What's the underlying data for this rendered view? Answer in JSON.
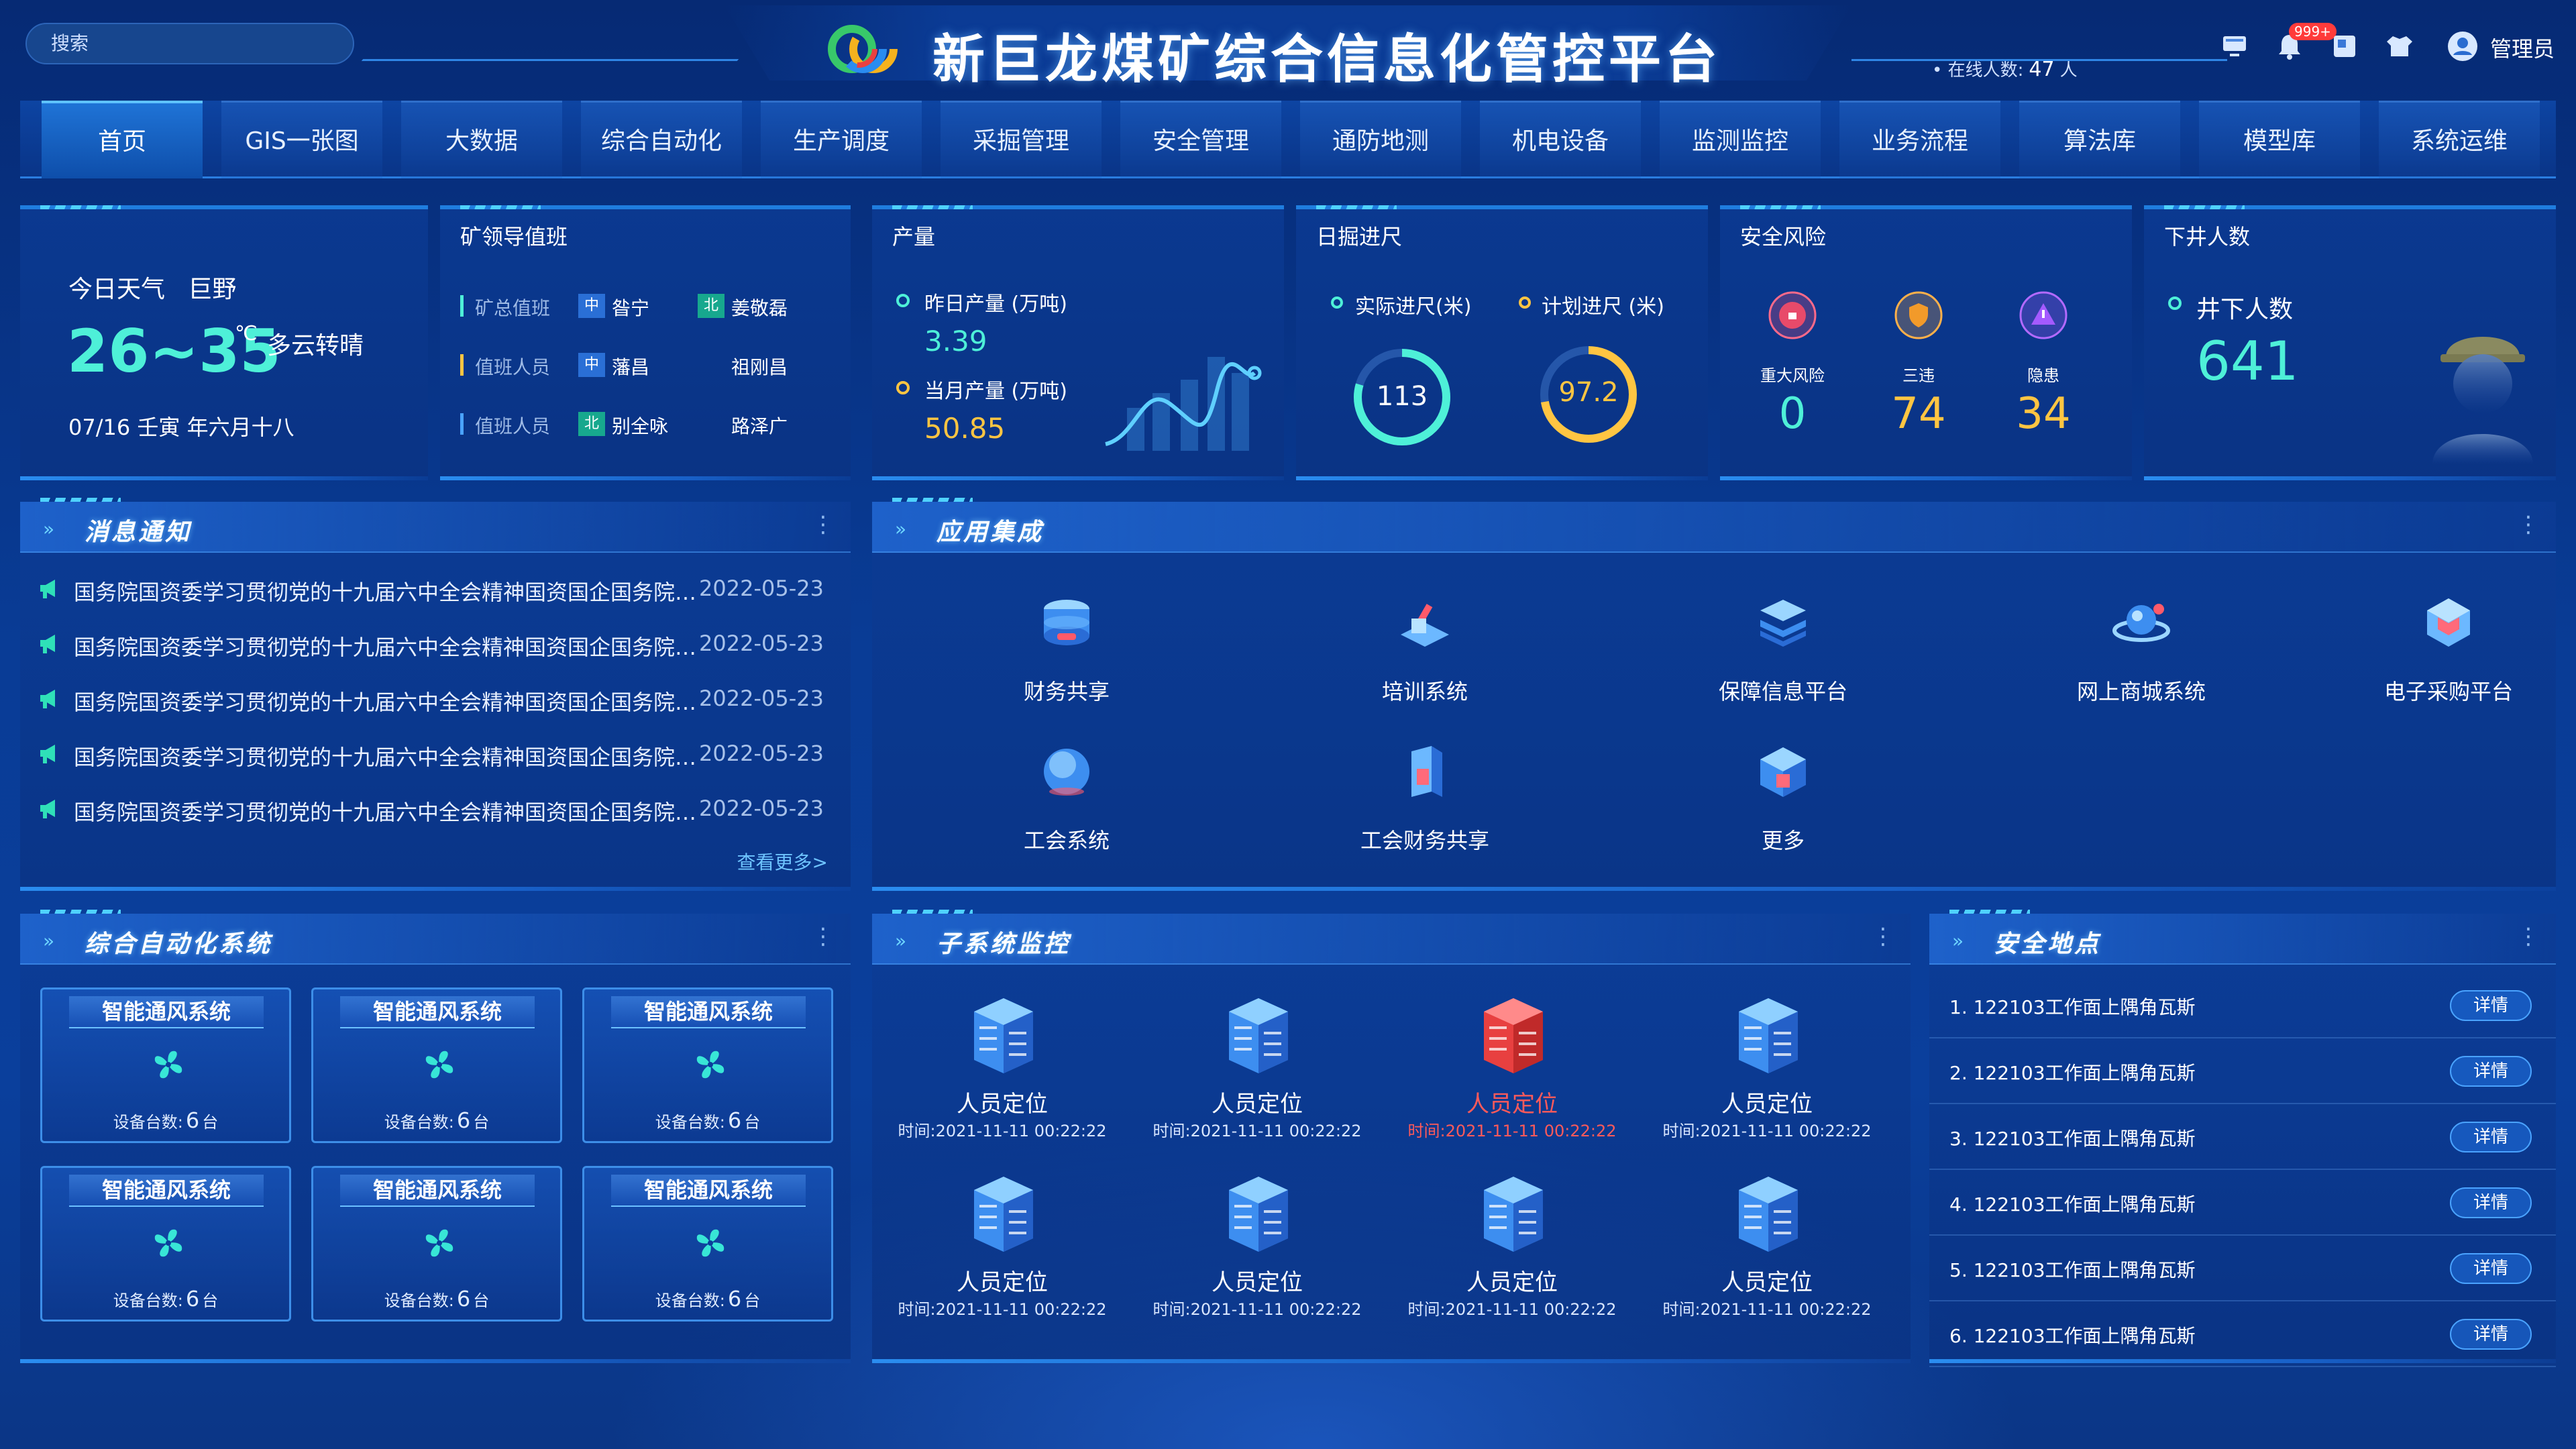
{
  "header": {
    "search_placeholder": "搜索",
    "title": "新巨龙煤矿综合信息化管控平台",
    "online_label": "在线人数:",
    "online_count": "47",
    "online_unit": "人",
    "badge": "999+",
    "user": "管理员"
  },
  "nav": [
    "首页",
    "GIS一张图",
    "大数据",
    "综合自动化",
    "生产调度",
    "采掘管理",
    "安全管理",
    "通防地测",
    "机电设备",
    "监测监控",
    "业务流程",
    "算法库",
    "模型库",
    "系统运维"
  ],
  "weather": {
    "label": "今日天气",
    "city": "巨野",
    "temp": "26~35",
    "unit": "℃",
    "desc": "多云转晴",
    "date": "07/16 壬寅 年六月十八"
  },
  "duty": {
    "title": "矿领导值班",
    "rows": [
      {
        "role": "矿总值班",
        "tag1": "中",
        "name1": "昝宁",
        "tag2": "北",
        "name2": "姜敬磊"
      },
      {
        "role": "值班人员",
        "tag1": "中",
        "name1": "藩昌",
        "tag2": "",
        "name2": "祖刚昌"
      },
      {
        "role": "值班人员",
        "tag1": "北",
        "name1": "别全咏",
        "tag2": "",
        "name2": "路泽广"
      }
    ]
  },
  "output": {
    "title": "产量",
    "yesterday_label": "昨日产量 (万吨)",
    "yesterday_value": "3.39",
    "month_label": "当月产量 (万吨)",
    "month_value": "50.85"
  },
  "advance": {
    "title": "日掘进尺",
    "actual_label": "实际进尺(米)",
    "plan_label": "计划进尺 (米)",
    "actual_value": "113",
    "plan_value": "97.2"
  },
  "risk": {
    "title": "安全风险",
    "items": [
      {
        "label": "重大风险",
        "value": "0"
      },
      {
        "label": "三违",
        "value": "74"
      },
      {
        "label": "隐患",
        "value": "34"
      }
    ]
  },
  "underground": {
    "title": "下井人数",
    "label": "井下人数",
    "value": "641"
  },
  "messages": {
    "title": "消息通知",
    "more": "查看更多>",
    "items": [
      {
        "text": "国务院国资委学习贯彻党的十九届六中全会精神国资国企国务院国资委学习贯彻党的十九届六中全会精神",
        "date": "2022-05-23"
      },
      {
        "text": "国务院国资委学习贯彻党的十九届六中全会精神国资国企国务院国资委学习贯彻党的十九届六中全会精神",
        "date": "2022-05-23"
      },
      {
        "text": "国务院国资委学习贯彻党的十九届六中全会精神国资国企国务院国资委学习贯彻党的十九届六中全会精神",
        "date": "2022-05-23"
      },
      {
        "text": "国务院国资委学习贯彻党的十九届六中全会精神国资国企国务院国资委学习贯彻党的十九届六中全会精神",
        "date": "2022-05-23"
      },
      {
        "text": "国务院国资委学习贯彻党的十九届六中全会精神国资国企国务院国资委学习贯彻党的十九届六中全会精神",
        "date": "2022-05-23"
      }
    ]
  },
  "apps": {
    "title": "应用集成",
    "items": [
      "财务共享",
      "培训系统",
      "保障信息平台",
      "网上商城系统",
      "电子采购平台",
      "工会系统",
      "工会财务共享",
      "更多"
    ]
  },
  "automation": {
    "title": "综合自动化系统",
    "card_title": "智能通风系统",
    "count_label": "设备台数:",
    "count_value": "6",
    "count_unit": "台"
  },
  "subsystem": {
    "title": "子系统监控",
    "name": "人员定位",
    "time": "时间:2021-11-11 00:22:22"
  },
  "safety": {
    "title": "安全地点",
    "btn": "详情",
    "items": [
      "1.  122103工作面上隅角瓦斯",
      "2.  122103工作面上隅角瓦斯",
      "3.  122103工作面上隅角瓦斯",
      "4.  122103工作面上隅角瓦斯",
      "5.  122103工作面上隅角瓦斯",
      "6.  122103工作面上隅角瓦斯"
    ]
  },
  "colors": {
    "accent": "#4ef0d8",
    "warn": "#ffc542",
    "alarm": "#ff4a4a",
    "bg": "#0a3f9c"
  },
  "icons": [
    "monitor-icon",
    "bell-icon",
    "window-icon",
    "shirt-icon",
    "user-icon",
    "megaphone-icon",
    "fan-icon",
    "server-icon"
  ]
}
